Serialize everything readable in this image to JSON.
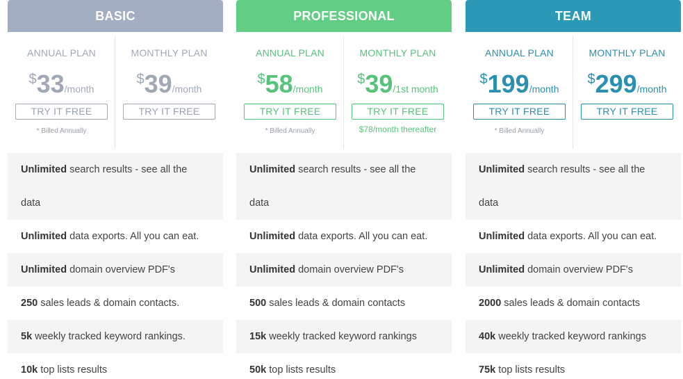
{
  "plans": [
    {
      "name": "BASIC",
      "annual": {
        "label": "ANNUAL PLAN",
        "currency": "$",
        "price": "33",
        "period": "/month",
        "button": "TRY IT FREE",
        "note": "* Billed Annually"
      },
      "monthly": {
        "label": "MONTHLY PLAN",
        "currency": "$",
        "price": "39",
        "period": "/month",
        "button": "TRY IT FREE",
        "note": ""
      },
      "features": [
        {
          "strong": "Unlimited",
          "text": " search results - see all the data"
        },
        {
          "strong": "Unlimited",
          "text": " data exports. All you can eat."
        },
        {
          "strong": "Unlimited",
          "text": " domain overview PDF's"
        },
        {
          "strong": "250",
          "text": " sales leads & domain contacts."
        },
        {
          "strong": "5k",
          "text": " weekly tracked keyword rankings."
        },
        {
          "strong": "10k",
          "text": " top lists results"
        }
      ]
    },
    {
      "name": "PROFESSIONAL",
      "annual": {
        "label": "ANNUAL PLAN",
        "currency": "$",
        "price": "58",
        "period": "/month",
        "button": "TRY IT FREE",
        "note": "* Billed Annually"
      },
      "monthly": {
        "label": "MONTHLY PLAN",
        "currency": "$",
        "price": "39",
        "period": "/1st month",
        "button": "TRY IT FREE",
        "note": "$78/month thereafter"
      },
      "features": [
        {
          "strong": "Unlimited",
          "text": " search results - see all the data"
        },
        {
          "strong": "Unlimited",
          "text": " data exports. All you can eat."
        },
        {
          "strong": "Unlimited",
          "text": " domain overview PDF's"
        },
        {
          "strong": "500",
          "text": " sales leads & domain contacts"
        },
        {
          "strong": "15k",
          "text": " weekly tracked keyword rankings"
        },
        {
          "strong": "50k",
          "text": " top lists results"
        }
      ]
    },
    {
      "name": "TEAM",
      "annual": {
        "label": "ANNUAL PLAN",
        "currency": "$",
        "price": "199",
        "period": "/month",
        "button": "TRY IT FREE",
        "note": "* Billed Annually"
      },
      "monthly": {
        "label": "MONTHLY PLAN",
        "currency": "$",
        "price": "299",
        "period": "/month",
        "button": "TRY IT FREE",
        "note": ""
      },
      "features": [
        {
          "strong": "Unlimited",
          "text": " search results - see all the data"
        },
        {
          "strong": "Unlimited",
          "text": " data exports. All you can eat."
        },
        {
          "strong": "Unlimited",
          "text": " domain overview PDF's"
        },
        {
          "strong": "2000",
          "text": " sales leads & domain contacts"
        },
        {
          "strong": "40k",
          "text": " weekly tracked keyword rankings"
        },
        {
          "strong": "75k",
          "text": " top lists results"
        }
      ]
    }
  ],
  "colors": {
    "basic": "#a3aec2",
    "professional": "#63cc85",
    "team": "#2b98b6"
  }
}
